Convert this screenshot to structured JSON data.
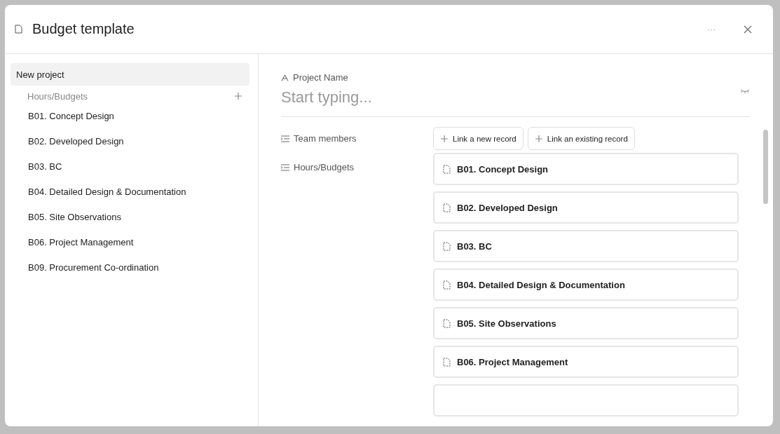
{
  "dialog": {
    "title": "Budget template",
    "menu_glyph": "···"
  },
  "sidebar": {
    "items": [
      {
        "label": "New project",
        "selected": true
      }
    ],
    "section": {
      "title": "Hours/Budgets",
      "items": [
        "B01. Concept Design",
        "B02. Developed Design",
        "B03. BC",
        "B04. Detailed Design & Documentation",
        "B05. Site Observations",
        "B06. Project Management",
        "B09. Procurement Co-ordination"
      ]
    }
  },
  "form": {
    "name_field": {
      "label": "Project Name",
      "placeholder": "Start typing..."
    },
    "fields": [
      {
        "label": "Team members",
        "kind": "buttons",
        "buttons": [
          "Link a new record",
          "Link an existing record"
        ]
      },
      {
        "label": "Hours/Budgets",
        "kind": "records",
        "records": [
          "B01. Concept Design",
          "B02. Developed Design",
          "B03. BC",
          "B04. Detailed Design & Documentation",
          "B05. Site Observations",
          "B06. Project Management"
        ],
        "more_below": true
      }
    ]
  }
}
